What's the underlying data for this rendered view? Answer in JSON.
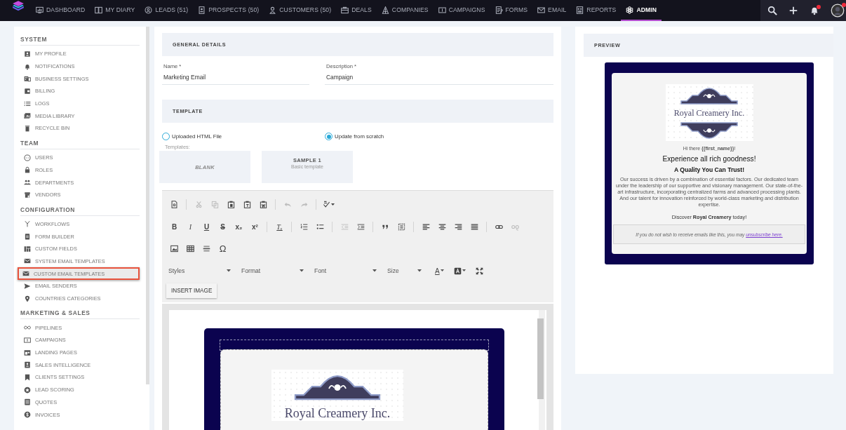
{
  "nav": {
    "items": [
      {
        "kind": "dashboard",
        "label": "DASHBOARD",
        "selected": false
      },
      {
        "kind": "diary",
        "label": "MY DIARY",
        "selected": false
      },
      {
        "kind": "leads",
        "label": "LEADS (51)",
        "selected": false
      },
      {
        "kind": "prospects",
        "label": "PROSPECTS (50)",
        "selected": false
      },
      {
        "kind": "customers",
        "label": "CUSTOMERS (50)",
        "selected": false
      },
      {
        "kind": "deals",
        "label": "DEALS",
        "selected": false
      },
      {
        "kind": "companies",
        "label": "COMPANIES",
        "selected": false
      },
      {
        "kind": "campaigns",
        "label": "CAMPAIGNS",
        "selected": false
      },
      {
        "kind": "forms",
        "label": "FORMS",
        "selected": false
      },
      {
        "kind": "email",
        "label": "EMAIL",
        "selected": false
      },
      {
        "kind": "reports",
        "label": "REPORTS",
        "selected": false
      },
      {
        "kind": "admin",
        "label": "ADMIN",
        "selected": true
      }
    ],
    "actions": [
      {
        "kind": "search",
        "badge": false
      },
      {
        "kind": "add",
        "badge": false
      },
      {
        "kind": "notifications",
        "badge": true
      },
      {
        "kind": "account",
        "badge": true
      }
    ]
  },
  "sidebar": {
    "sections": [
      {
        "title": "SYSTEM",
        "items": [
          {
            "kind": "profile",
            "label": "MY PROFILE",
            "selected": false
          },
          {
            "kind": "bell",
            "label": "NOTIFICATIONS",
            "selected": false
          },
          {
            "kind": "business",
            "label": "BUSINESS SETTINGS",
            "selected": false
          },
          {
            "kind": "billing",
            "label": "BILLING",
            "selected": false
          },
          {
            "kind": "logs",
            "label": "LOGS",
            "selected": false
          },
          {
            "kind": "media",
            "label": "MEDIA LIBRARY",
            "selected": false
          },
          {
            "kind": "trash",
            "label": "RECYCLE BIN",
            "selected": false
          }
        ]
      },
      {
        "title": "TEAM",
        "items": [
          {
            "kind": "users",
            "label": "USERS",
            "selected": false
          },
          {
            "kind": "roles",
            "label": "ROLES",
            "selected": false
          },
          {
            "kind": "departments",
            "label": "DEPARTMENTS",
            "selected": false
          },
          {
            "kind": "vendors",
            "label": "VENDORS",
            "selected": false
          }
        ]
      },
      {
        "title": "CONFIGURATION",
        "items": [
          {
            "kind": "workflows",
            "label": "WORKFLOWS",
            "selected": false
          },
          {
            "kind": "formbuilder",
            "label": "FORM BUILDER",
            "selected": false
          },
          {
            "kind": "fields",
            "label": "CUSTOM FIELDS",
            "selected": false
          },
          {
            "kind": "mail",
            "label": "SYSTEM EMAIL TEMPLATES",
            "selected": false
          },
          {
            "kind": "mail",
            "label": "CUSTOM EMAIL TEMPLATES",
            "selected": true
          },
          {
            "kind": "send",
            "label": "EMAIL SENDERS",
            "selected": false
          },
          {
            "kind": "pin",
            "label": "COUNTRIES CATEGORIES",
            "selected": false
          }
        ]
      },
      {
        "title": "MARKETING & SALES",
        "items": [
          {
            "kind": "pipelines",
            "label": "PIPELINES",
            "selected": false
          },
          {
            "kind": "campaigns",
            "label": "CAMPAIGNS",
            "selected": false
          },
          {
            "kind": "landing",
            "label": "LANDING PAGES",
            "selected": false
          },
          {
            "kind": "intel",
            "label": "SALES INTELLIGENCE",
            "selected": false
          },
          {
            "kind": "bookmark",
            "label": "CLIENTS SETTINGS",
            "selected": false
          },
          {
            "kind": "scoring",
            "label": "LEAD SCORING",
            "selected": false
          },
          {
            "kind": "quotes",
            "label": "QUOTES",
            "selected": false
          },
          {
            "kind": "invoices",
            "label": "INVOICES",
            "selected": false
          }
        ]
      }
    ]
  },
  "form": {
    "general": {
      "title": "GENERAL DETAILS",
      "fields": [
        {
          "label": "Name *",
          "value": "Marketing Email"
        },
        {
          "label": "Description *",
          "value": "Campaign"
        }
      ]
    },
    "template": {
      "title": "TEMPLATE",
      "options": [
        {
          "label": "Uploaded HTML File",
          "selected": false
        },
        {
          "label": "Update from scratch",
          "selected": true
        }
      ],
      "templates_label": "Templates:",
      "templates": [
        {
          "kind": "blank",
          "title": "BLANK"
        },
        {
          "kind": "sample",
          "title": "SAMPLE 1",
          "subtitle": "Basic template"
        }
      ]
    },
    "editor": {
      "toolbar": [
        [
          [
            {
              "kind": "source",
              "disabled": false
            }
          ],
          [
            {
              "kind": "cut",
              "disabled": true
            },
            {
              "kind": "copy",
              "disabled": true
            },
            {
              "kind": "paste",
              "disabled": false
            },
            {
              "kind": "pastetext",
              "disabled": false
            },
            {
              "kind": "pasteword",
              "disabled": false
            }
          ],
          [
            {
              "kind": "undo",
              "disabled": true
            },
            {
              "kind": "redo",
              "disabled": true
            }
          ],
          [
            {
              "kind": "spell",
              "disabled": false,
              "dropdown": true
            }
          ]
        ],
        [
          [
            {
              "kind": "bold",
              "label": "B",
              "disabled": false
            },
            {
              "kind": "italic",
              "label": "I",
              "disabled": false
            },
            {
              "kind": "underline",
              "label": "U",
              "disabled": false
            },
            {
              "kind": "strike",
              "label": "S",
              "disabled": false
            },
            {
              "kind": "sub",
              "label": "x₂",
              "disabled": false
            },
            {
              "kind": "sup",
              "label": "x²",
              "disabled": false
            }
          ],
          [
            {
              "kind": "clear",
              "label": "Tₓ",
              "disabled": false
            }
          ],
          [
            {
              "kind": "ol",
              "disabled": false
            },
            {
              "kind": "ul",
              "disabled": false
            }
          ],
          [
            {
              "kind": "outdent",
              "disabled": true
            },
            {
              "kind": "indent",
              "disabled": false
            }
          ],
          [
            {
              "kind": "quote",
              "disabled": false
            },
            {
              "kind": "div",
              "disabled": false
            }
          ],
          [
            {
              "kind": "left",
              "disabled": false
            },
            {
              "kind": "center",
              "disabled": false
            },
            {
              "kind": "right",
              "disabled": false
            },
            {
              "kind": "justify",
              "disabled": false
            }
          ],
          [
            {
              "kind": "link",
              "disabled": false
            },
            {
              "kind": "unlink",
              "disabled": true
            }
          ]
        ],
        [
          [
            {
              "kind": "image",
              "disabled": false
            },
            {
              "kind": "table",
              "disabled": false
            },
            {
              "kind": "hr",
              "disabled": false
            },
            {
              "kind": "symbol",
              "label": "Ω",
              "disabled": false
            }
          ]
        ]
      ],
      "combos": [
        {
          "kind": "wide",
          "label": "Styles"
        },
        {
          "kind": "wide",
          "label": "Format"
        },
        {
          "kind": "wide",
          "label": "Font"
        },
        {
          "kind": "narrow",
          "label": "Size"
        }
      ],
      "color_buttons": [
        {
          "kind": "textcolor",
          "label": "A"
        },
        {
          "kind": "bgcolor"
        },
        {
          "kind": "maximize"
        }
      ],
      "insert_button": "INSERT IMAGE",
      "logo_text": "Royal Creamery Inc."
    }
  },
  "preview": {
    "title": "PREVIEW",
    "email": {
      "logo_text": "Royal Creamery Inc.",
      "greeting": "Hi there **{{first_name}}**!",
      "heading": "Experience all rich goodness!",
      "subheading": "A Quality You Can Trust!",
      "body": "Our success is driven by a combination of essential factors. Our dedicated team under the leadership of our supportive and visionary management. Our state-of-the-art infrastructure, incorporating centralized farms and advanced processing plants. And our talent for innovation reinforced by world-class marketing and distribution expertise.",
      "closing": "Discover **Royal Creamery** today!",
      "footer_text": "If you do not wish to receive emails like this, you may ",
      "footer_link": "unsubscribe here."
    }
  }
}
